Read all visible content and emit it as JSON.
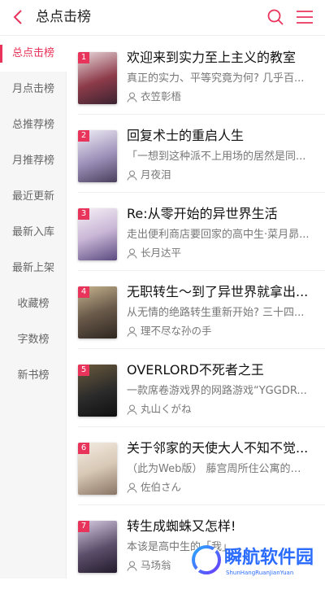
{
  "header": {
    "title": "总点击榜"
  },
  "colors": {
    "accent": "#e8345a"
  },
  "sidebar": {
    "items": [
      {
        "label": "总点击榜",
        "active": true
      },
      {
        "label": "月点击榜",
        "active": false
      },
      {
        "label": "总推荐榜",
        "active": false
      },
      {
        "label": "月推荐榜",
        "active": false
      },
      {
        "label": "最近更新",
        "active": false
      },
      {
        "label": "最新入库",
        "active": false
      },
      {
        "label": "最新上架",
        "active": false
      },
      {
        "label": "收藏榜",
        "active": false
      },
      {
        "label": "字数榜",
        "active": false
      },
      {
        "label": "新书榜",
        "active": false
      }
    ]
  },
  "books": [
    {
      "rank": "1",
      "title": "欢迎来到实力至上主义的教室",
      "desc": "真正的实力、平等究竟为何? 几乎百...",
      "author": "衣笠彰梧",
      "cover_color": "#8d3b4a"
    },
    {
      "rank": "2",
      "title": "回复术士的重启人生",
      "desc": "「一想到这种派不上用场的居然是同...",
      "author": "月夜泪",
      "cover_color": "#9b8fb8"
    },
    {
      "rank": "3",
      "title": "Re:从零开始的异世界生活",
      "desc": "走出便利商店要回家的高中生·菜月昴...",
      "author": "长月达平",
      "cover_color": "#c9b6d6"
    },
    {
      "rank": "4",
      "title": "无职转生～到了异世界就拿出...",
      "desc": "从无情的绝路转生重新开始? 三十四...",
      "author": "理不尽な孙の手",
      "cover_color": "#6a5a4a"
    },
    {
      "rank": "5",
      "title": "OVERLORD不死者之王",
      "desc": "一款席卷游戏界的网路游戏“YGGDR...",
      "author": "丸山くがね",
      "cover_color": "#2b2b2b"
    },
    {
      "rank": "6",
      "title": "关于邻家的天使大人不知不觉...",
      "desc": "（此为Web版） 藤宫周所住公寓的隔...",
      "author": "佐伯さん",
      "cover_color": "#d8c8b6"
    },
    {
      "rank": "7",
      "title": "转生成蜘蛛又怎样!",
      "desc": "本该是高中生的「我」...",
      "author": "马场翁",
      "cover_color": "#5b4e6a"
    }
  ],
  "watermark": {
    "text": "瞬航软件园",
    "sub": "ShunHangRuanJianYuan"
  }
}
